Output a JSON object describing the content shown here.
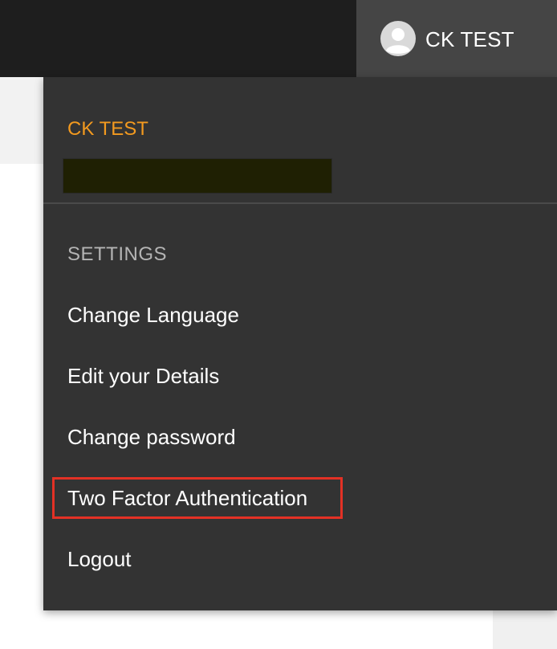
{
  "header": {
    "user_name": "CK TEST",
    "avatar_icon": "user-avatar-icon"
  },
  "dropdown": {
    "user_name": "CK TEST",
    "user_name_color": "#f39a1f",
    "section_label": "SETTINGS",
    "items": [
      {
        "label": "Change Language"
      },
      {
        "label": "Edit your Details"
      },
      {
        "label": "Change password"
      },
      {
        "label": "Two Factor Authentication",
        "highlighted": true
      },
      {
        "label": "Logout"
      }
    ],
    "highlight_color": "#e33125"
  }
}
